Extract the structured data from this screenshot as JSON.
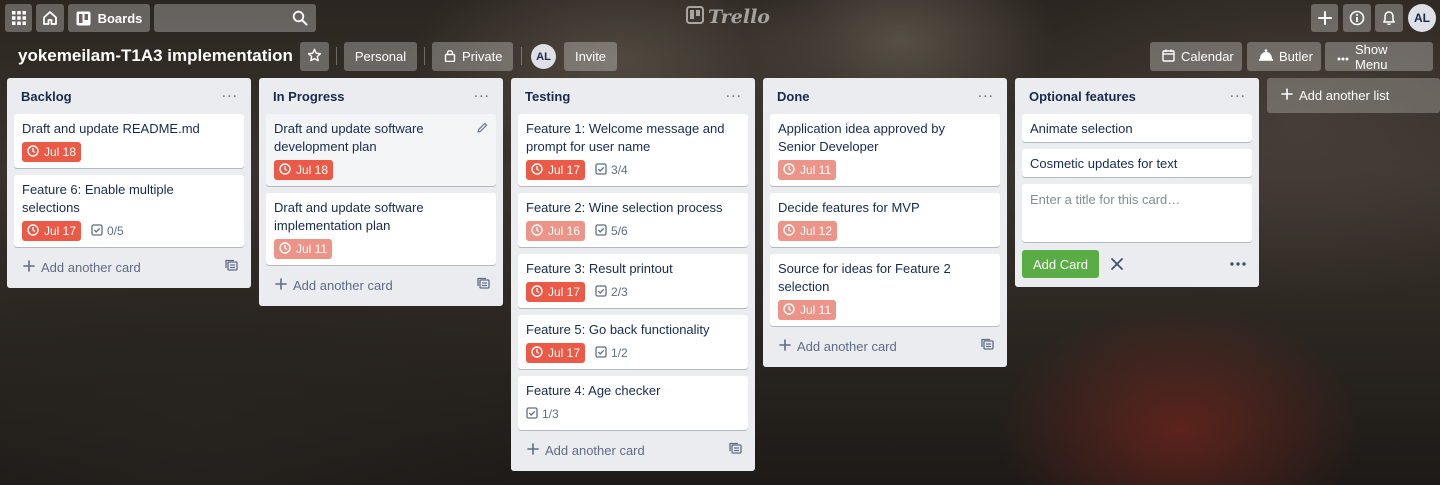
{
  "topbar": {
    "boards_label": "Boards",
    "logo_text": "Trello",
    "user_initials": "AL"
  },
  "header": {
    "board_title": "yokemeilam-T1A3 implementation",
    "team_label": "Personal",
    "visibility_label": "Private",
    "member_initials": "AL",
    "invite_label": "Invite",
    "calendar_label": "Calendar",
    "butler_label": "Butler",
    "show_menu_label": "Show Menu"
  },
  "lists": [
    {
      "title": "Backlog",
      "cards": [
        {
          "title": "Draft and update README.md",
          "due": "Jul 18",
          "due_state": "overdue"
        },
        {
          "title": "Feature 6: Enable multiple selections",
          "due": "Jul 17",
          "due_state": "overdue",
          "checklist": "0/5"
        }
      ],
      "add_label": "Add another card"
    },
    {
      "title": "In Progress",
      "cards": [
        {
          "title": "Draft and update software development plan",
          "due": "Jul 18",
          "due_state": "overdue",
          "hover": true
        },
        {
          "title": "Draft and update software implementation plan",
          "due": "Jul 11",
          "due_state": "past"
        }
      ],
      "add_label": "Add another card"
    },
    {
      "title": "Testing",
      "cards": [
        {
          "title": "Feature 1: Welcome message and prompt for user name",
          "due": "Jul 17",
          "due_state": "overdue",
          "checklist": "3/4"
        },
        {
          "title": "Feature 2: Wine selection process",
          "due": "Jul 16",
          "due_state": "past",
          "checklist": "5/6"
        },
        {
          "title": "Feature 3: Result printout",
          "due": "Jul 17",
          "due_state": "overdue",
          "checklist": "2/3"
        },
        {
          "title": "Feature 5: Go back functionality",
          "due": "Jul 17",
          "due_state": "overdue",
          "checklist": "1/2"
        },
        {
          "title": "Feature 4: Age checker",
          "checklist": "1/3"
        }
      ],
      "add_label": "Add another card"
    },
    {
      "title": "Done",
      "cards": [
        {
          "title": "Application idea approved by Senior Developer",
          "due": "Jul 11",
          "due_state": "past"
        },
        {
          "title": "Decide features for MVP",
          "due": "Jul 12",
          "due_state": "past"
        },
        {
          "title": "Source for ideas for Feature 2 selection",
          "due": "Jul 11",
          "due_state": "past"
        }
      ],
      "add_label": "Add another card"
    },
    {
      "title": "Optional features",
      "cards": [
        {
          "title": "Animate selection"
        },
        {
          "title": "Cosmetic updates for text"
        }
      ],
      "composer_placeholder": "Enter a title for this card…",
      "composer_button": "Add Card"
    }
  ],
  "add_list_label": "Add another list",
  "colors": {
    "overdue": "#eb5a46",
    "past_due": "#ec9488",
    "add_button": "#5aac44",
    "list_bg": "#ebecf0"
  }
}
